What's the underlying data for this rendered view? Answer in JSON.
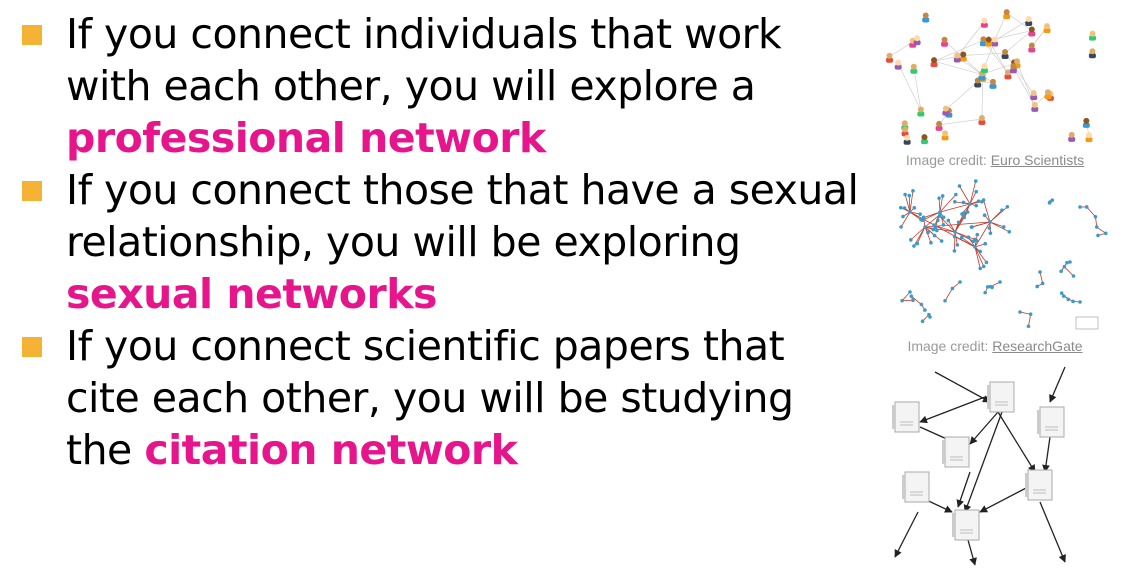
{
  "bullets": [
    {
      "text": "If you connect individuals that work with each other, you will explore a ",
      "highlight": "professional network"
    },
    {
      "text": "If you connect those that have a sexual relationship, you will be exploring ",
      "highlight": "sexual networks"
    },
    {
      "text": "If you connect scientific papers that cite each other, you will be studying the ",
      "highlight": "citation network"
    }
  ],
  "figures": [
    {
      "icon": "social-network-people-image",
      "caption_prefix": "Image credit: ",
      "caption_link": "Euro Scientists"
    },
    {
      "icon": "sexual-network-graph-image",
      "caption_prefix": "Image credit: ",
      "caption_link": "ResearchGate"
    },
    {
      "icon": "citation-network-diagram-image"
    }
  ],
  "colors": {
    "bullet": "#f5b335",
    "highlight": "#e6158c",
    "node": "#3a9bc9",
    "edge": "#c0392b"
  }
}
